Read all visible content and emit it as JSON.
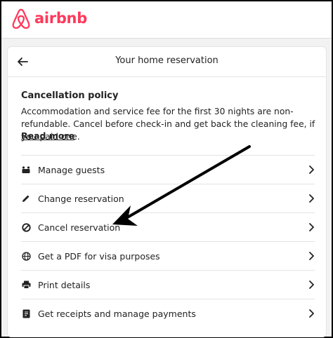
{
  "brand": {
    "name": "airbnb",
    "color": "#FF385C",
    "icon": "airbnb-logo-icon"
  },
  "header": {
    "title": "Your home reservation",
    "back_icon": "back-arrow-icon"
  },
  "policy": {
    "title": "Cancellation policy",
    "text": "Accommodation and service fee for the first 30 nights are non-refundable. Cancel before check-in and get back the cleaning fee, if you paid one.",
    "read_more": "Read more"
  },
  "menu": {
    "items": [
      {
        "label": "Manage guests",
        "icon": "guests-icon"
      },
      {
        "label": "Change reservation",
        "icon": "pencil-icon"
      },
      {
        "label": "Cancel reservation",
        "icon": "cancel-icon"
      },
      {
        "label": "Get a PDF for visa purposes",
        "icon": "globe-icon"
      },
      {
        "label": "Print details",
        "icon": "printer-icon"
      },
      {
        "label": "Get receipts and manage payments",
        "icon": "receipt-icon"
      }
    ]
  },
  "annotation": {
    "arrow": "pointer-arrow",
    "target": "Cancel reservation"
  }
}
